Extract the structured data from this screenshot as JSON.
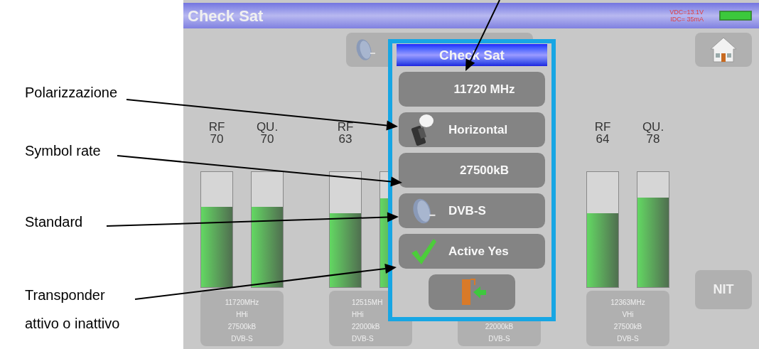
{
  "annotations": [
    {
      "kind": "polarization",
      "label": "Polarizzazione"
    },
    {
      "kind": "symbol",
      "label": "Symbol rate"
    },
    {
      "kind": "standard",
      "label": "Standard"
    },
    {
      "kind": "active",
      "label": "Transponder attivo o inattivo"
    }
  ],
  "header": {
    "title": "Check Sat",
    "voltage": "VDC=13.1V",
    "current": "IDC= 35mA"
  },
  "channels": [
    {
      "meters": [
        {
          "label": "RF",
          "value": "70",
          "level": 0.7
        },
        {
          "label": "QU.",
          "value": "70",
          "level": 0.7
        }
      ],
      "info": [
        "11720MHz",
        "HHi",
        "27500kB",
        "DVB-S"
      ]
    },
    {
      "meters": [
        {
          "label": "RF",
          "value": "63",
          "level": 0.64
        },
        {
          "level": 0.77
        }
      ],
      "info": [
        "12515MH",
        "HHi",
        "22000kB",
        "DVB-S"
      ]
    },
    {
      "info": [
        "22000kB",
        "DVB-S"
      ]
    },
    {
      "meters": [
        {
          "label": "RF",
          "value": "64",
          "level": 0.64
        },
        {
          "label": "QU.",
          "value": "78",
          "level": 0.78
        }
      ],
      "info": [
        "12363MHz",
        "VHi",
        "27500kB",
        "DVB-S"
      ]
    }
  ],
  "nit_button": "NIT",
  "dialog": {
    "title": "Check Sat",
    "rows": [
      {
        "kind": "plain",
        "label": "11720 MHz"
      },
      {
        "kind": "lnb",
        "label": "Horizontal"
      },
      {
        "kind": "plain",
        "label": "27500kB"
      },
      {
        "kind": "dish",
        "label": "DVB-S"
      },
      {
        "kind": "check",
        "label": "Active Yes"
      }
    ]
  }
}
